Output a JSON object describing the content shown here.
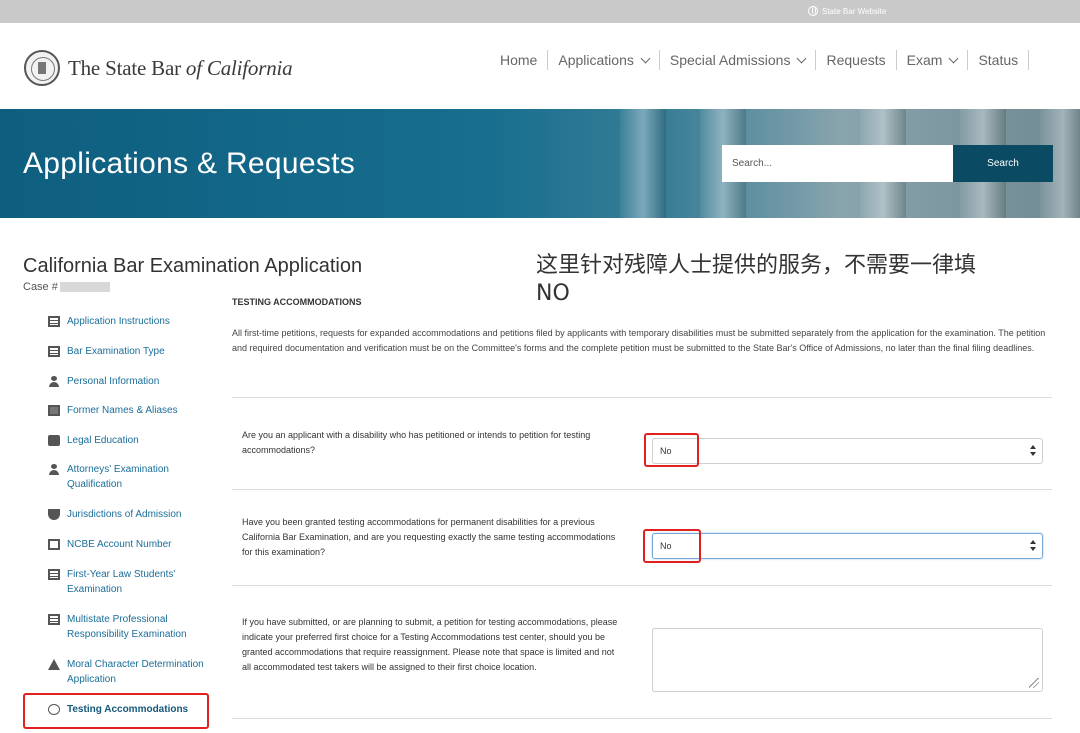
{
  "topbar": {
    "site_link": "State Bar Website"
  },
  "header": {
    "logo_pre": "The State Bar ",
    "logo_ital": "of California",
    "nav": [
      {
        "label": "Home",
        "dropdown": false
      },
      {
        "label": "Applications",
        "dropdown": true
      },
      {
        "label": "Special Admissions",
        "dropdown": true
      },
      {
        "label": "Requests",
        "dropdown": false
      },
      {
        "label": "Exam",
        "dropdown": true
      },
      {
        "label": "Status",
        "dropdown": false
      }
    ]
  },
  "banner": {
    "title": "Applications & Requests",
    "search_placeholder": "Search...",
    "search_button": "Search"
  },
  "page": {
    "title": "California Bar Examination Application",
    "case_label": "Case #"
  },
  "annotation": {
    "line1": "这里针对残障人士提供的服务，不需要一律填",
    "line2": "NO"
  },
  "sidebar": {
    "items": [
      {
        "label": "Application Instructions"
      },
      {
        "label": "Bar Examination Type"
      },
      {
        "label": "Personal Information"
      },
      {
        "label": "Former Names & Aliases"
      },
      {
        "label": "Legal Education"
      },
      {
        "label": "Attorneys' Examination Qualification"
      },
      {
        "label": "Jurisdictions of Admission"
      },
      {
        "label": "NCBE Account Number"
      },
      {
        "label": "First-Year Law Students' Examination"
      },
      {
        "label": "Multistate Professional Responsibility Examination"
      },
      {
        "label": "Moral Character Determination Application"
      },
      {
        "label": "Testing Accommodations"
      }
    ]
  },
  "main": {
    "section_title": "TESTING ACCOMMODATIONS",
    "intro": "All first-time petitions, requests for expanded accommodations and petitions filed by applicants with temporary disabilities must be submitted separately from the application for the examination. The petition and required documentation and verification must be on the Committee's forms and the complete petition must be submitted to the State Bar's Office of Admissions, no later than the final filing deadlines.",
    "questions": [
      {
        "label": "Are you an applicant with a disability who has petitioned or intends to petition for testing accommodations?",
        "value": "No"
      },
      {
        "label": "Have you been granted testing accommodations for permanent disabilities for a previous California Bar Examination, and are you requesting exactly the same testing accommodations for this examination?",
        "value": "No"
      },
      {
        "label": "If you have submitted, or are planning to submit, a petition for testing accommodations, please indicate your preferred first choice for a Testing Accommodations test center, should you be granted accommodations that require reassignment. Please note that space is limited and not all accommodated test takers will be assigned to their first choice location.",
        "value": ""
      }
    ]
  },
  "colors": {
    "banner": "#0e5e7f",
    "search_button": "#0b4a63",
    "link": "#1a6e99",
    "highlight": "#e32020"
  }
}
